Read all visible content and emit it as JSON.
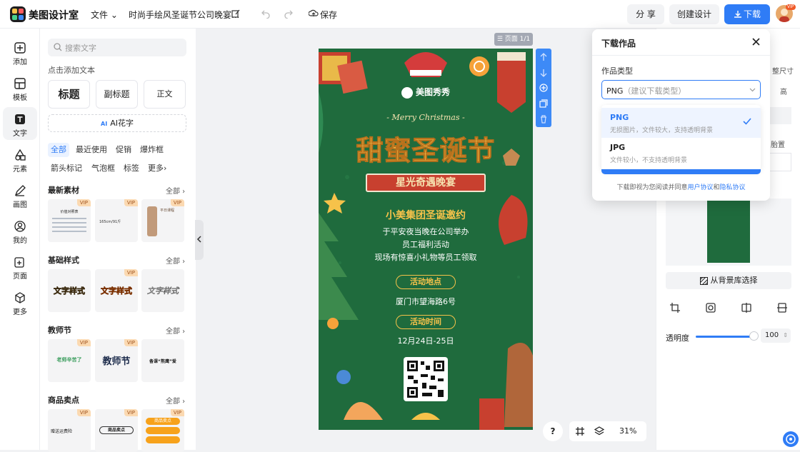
{
  "header": {
    "brand": "美图设计室",
    "file_menu": "文件",
    "doc_title": "时尚手绘风圣诞节公司晚宴...",
    "save": "保存",
    "share": "分 享",
    "create": "创建设计",
    "download": "下载",
    "vip_badge": "VIP"
  },
  "rail": [
    {
      "label": "添加",
      "icon": "plus-square-icon"
    },
    {
      "label": "模板",
      "icon": "template-icon"
    },
    {
      "label": "文字",
      "icon": "text-icon"
    },
    {
      "label": "元素",
      "icon": "shapes-icon"
    },
    {
      "label": "画图",
      "icon": "pen-icon"
    },
    {
      "label": "我的",
      "icon": "user-icon"
    },
    {
      "label": "页面",
      "icon": "add-page-icon"
    },
    {
      "label": "更多",
      "icon": "cube-icon"
    }
  ],
  "text_panel": {
    "search_placeholder": "搜索文字",
    "hint": "点击添加文本",
    "title_btn": "标题",
    "subtitle_btn": "副标题",
    "body_btn": "正文",
    "ai_badge": "AI",
    "ai_btn": "AI花字",
    "chips": [
      "全部",
      "最近使用",
      "促销",
      "爆炸框",
      "箭头标记",
      "气泡框",
      "标签",
      "更多"
    ],
    "sections": [
      {
        "title": "最新素材",
        "all": "全部",
        "items": [
          "价值对照表",
          "165cm/91斤",
          "平日课程"
        ]
      },
      {
        "title": "基础样式",
        "all": "全部",
        "items": [
          "文字样式",
          "文字样式",
          "文字样式"
        ]
      },
      {
        "title": "教师节",
        "all": "全部",
        "items": [
          "老师辛苦了",
          "教师节",
          "备课“熬鹰”爱"
        ]
      },
      {
        "title": "商品卖点",
        "all": "全部",
        "items": [
          "赠送运费险",
          "商品卖点",
          "商品卖点"
        ]
      }
    ],
    "vip": "VIP"
  },
  "canvas": {
    "page_label": "页面 1/1",
    "brand": "美图秀秀",
    "script": "- Merry Christmas -",
    "title": "甜蜜圣诞节",
    "ribbon": "星光奇遇晚宴",
    "invite": "小美集团圣诞邀约",
    "line1": "于平安夜当晚在公司举办",
    "line2": "员工福利活动",
    "line3": "现场有惊喜小礼物等员工领取",
    "place_label": "活动地点",
    "place": "厦门市望海路6号",
    "time_label": "活动时间",
    "time": "12月24日-25日"
  },
  "bottom": {
    "help": "?",
    "zoom": "31%"
  },
  "right_panel": {
    "bg_lib": "从背景库选择",
    "opacity_label": "透明度",
    "opacity": "100",
    "peek_size": "整尺寸",
    "peek_h": "高",
    "peek_top": "胎置",
    "bg_color": "#1f6b3d"
  },
  "download_dialog": {
    "title": "下载作品",
    "type_label": "作品类型",
    "selected": "PNG",
    "selected_hint": "（建议下载类型）",
    "options": [
      {
        "name": "PNG",
        "desc": "无损图片，文件较大，支持透明背景",
        "selected": true
      },
      {
        "name": "JPG",
        "desc": "文件较小，不支持透明背景",
        "selected": false
      }
    ],
    "note_prefix": "下载即视为您阅读并同意",
    "user_agreement": "用户协议",
    "and": "和",
    "privacy": "隐私协议"
  },
  "colors": {
    "accent": "#2f7cf6",
    "poster_green": "#1f6b3d",
    "poster_gold": "#f6c24a",
    "ribbon_red": "#c8402f"
  }
}
